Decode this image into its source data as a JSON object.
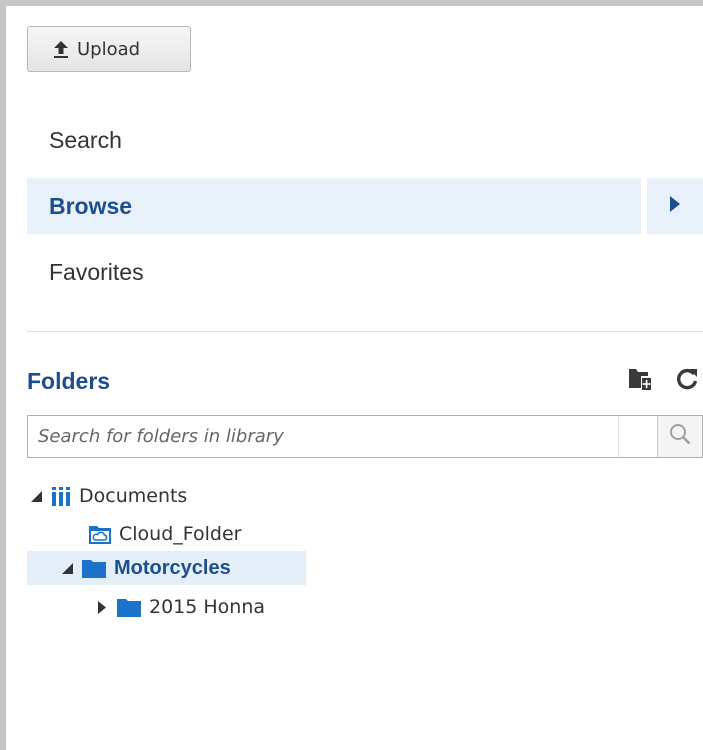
{
  "upload": {
    "label": "Upload",
    "icon": "upload-icon"
  },
  "nav": {
    "items": [
      {
        "label": "Search",
        "selected": false
      },
      {
        "label": "Browse",
        "selected": true,
        "icon": "chevron-right-icon"
      },
      {
        "label": "Favorites",
        "selected": false
      }
    ]
  },
  "folders": {
    "title": "Folders",
    "new_folder_icon": "new-folder-icon",
    "refresh_icon": "refresh-icon",
    "search": {
      "placeholder": "Search for folders in library",
      "value": "",
      "icon": "magnifier-icon"
    },
    "tree": [
      {
        "label": "Documents",
        "icon": "library-icon",
        "expanded": true,
        "selected": false
      },
      {
        "label": "Cloud_Folder",
        "icon": "cloud-folder-icon",
        "selected": false
      },
      {
        "label": "Motorcycles",
        "icon": "folder-icon",
        "expanded": true,
        "selected": true
      },
      {
        "label": "2015 Honna",
        "icon": "folder-icon",
        "expanded": false,
        "selected": false
      }
    ]
  },
  "colors": {
    "accent": "#1c4f8c",
    "selected_bg": "#e8f0f9",
    "folder_blue": "#1a73c8"
  }
}
